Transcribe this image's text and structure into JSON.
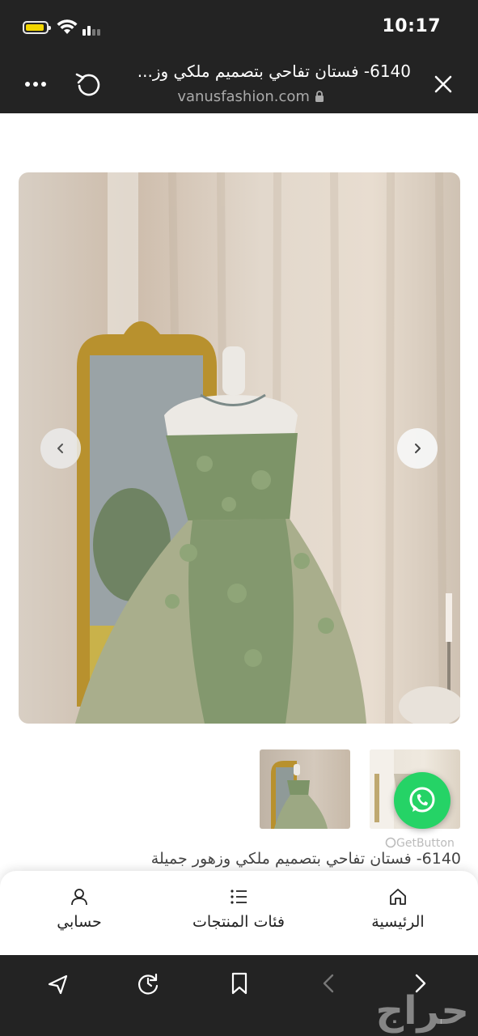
{
  "status_bar": {
    "time": "10:17"
  },
  "browser": {
    "page_title": "6140- فستان تفاحي بتصميم ملكي وز...",
    "domain": "vanusfashion.com"
  },
  "gallery": {
    "current_image": 1
  },
  "whatsapp": {
    "brand_label": "GetButton"
  },
  "product": {
    "title": "6140- فستان تفاحي بتصميم ملكي وزهور جميلة"
  },
  "tabs": [
    {
      "label": "الرئيسية",
      "icon": "home-icon"
    },
    {
      "label": "فئات المنتجات",
      "icon": "list-icon"
    },
    {
      "label": "حسابي",
      "icon": "user-icon"
    }
  ],
  "watermark": {
    "text": "حراج"
  },
  "colors": {
    "header_bg": "#232323",
    "whatsapp_green": "#25d366",
    "dress_green": "#7d9468"
  }
}
